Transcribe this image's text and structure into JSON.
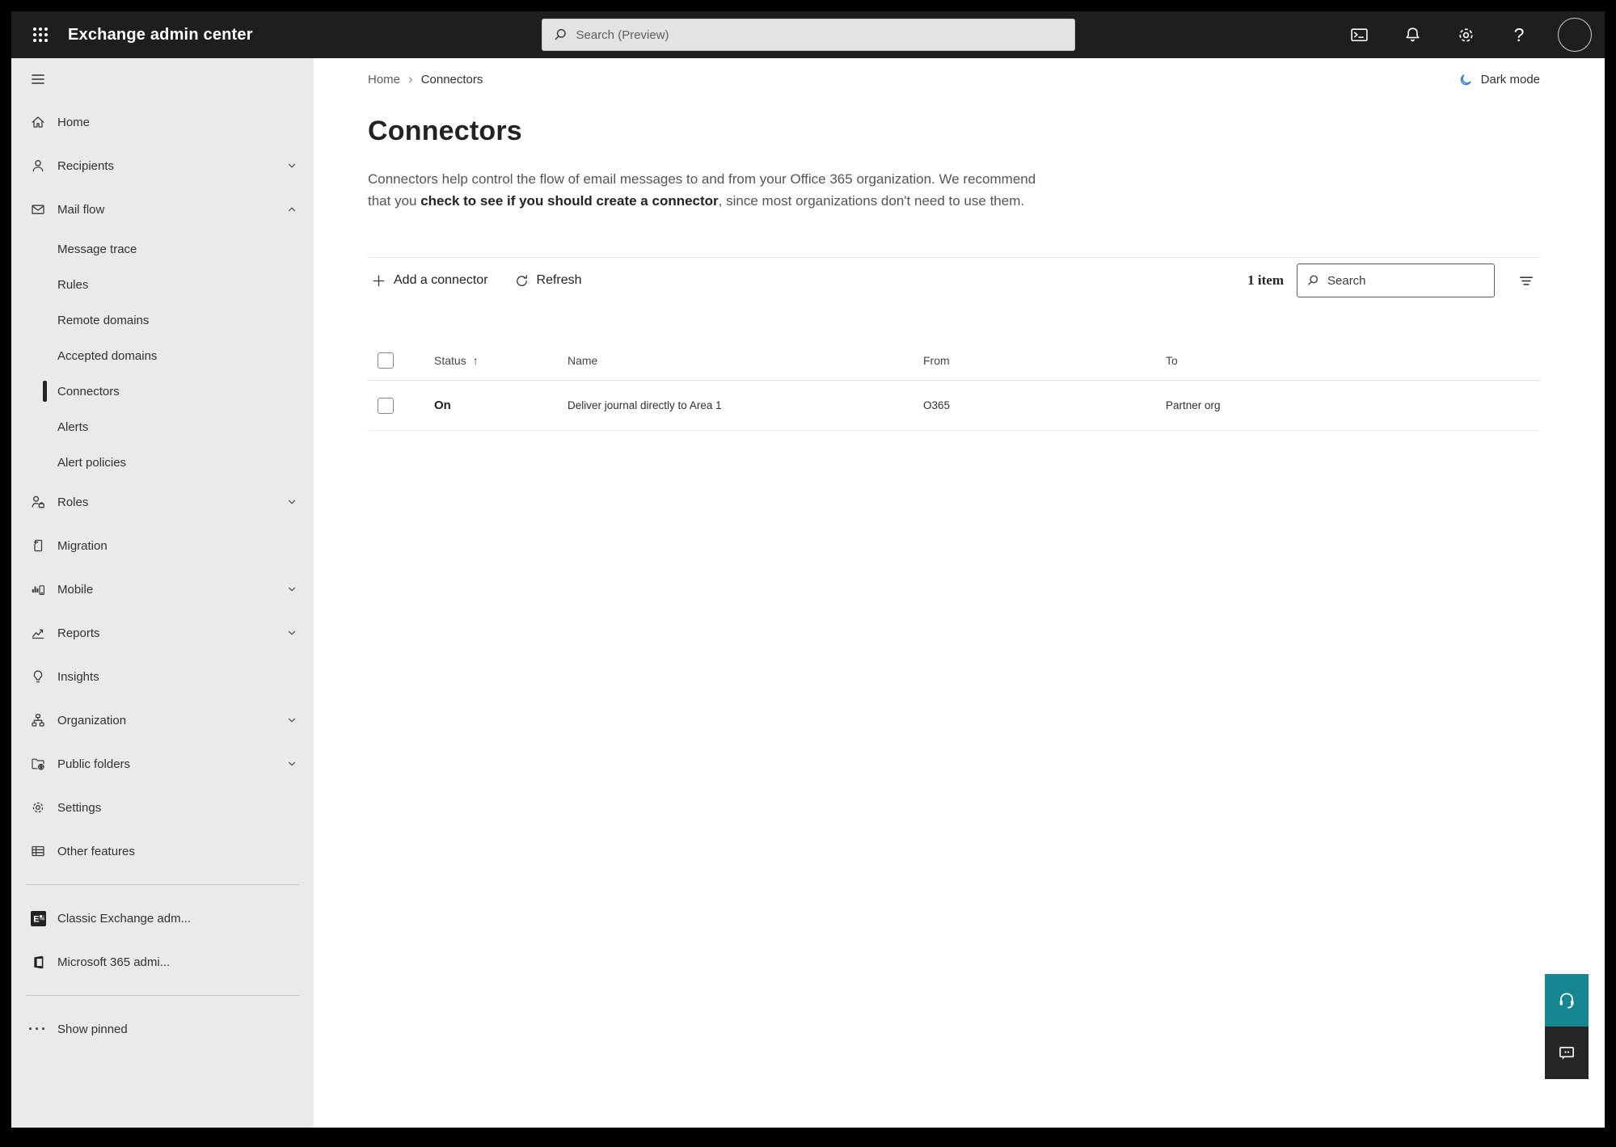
{
  "topbar": {
    "title": "Exchange admin center",
    "search_placeholder": "Search (Preview)",
    "help_glyph": "?"
  },
  "breadcrumb": {
    "home": "Home",
    "separator": "›",
    "current": "Connectors"
  },
  "theme_toggle": {
    "label": "Dark mode"
  },
  "page": {
    "title": "Connectors",
    "description": {
      "part1": "Connectors help control the flow of email messages to and from your Office 365 organization. We recommend that you ",
      "emphasis": "check to see if you should create a connector",
      "part2": ", since most organizations don't need to use them."
    }
  },
  "toolbar": {
    "add_connector_label": "Add a connector",
    "refresh_label": "Refresh",
    "item_count": "1 item",
    "search_placeholder": "Search"
  },
  "table": {
    "headers": {
      "status": "Status",
      "name": "Name",
      "from": "From",
      "to": "To"
    },
    "sort_indicator": "↑",
    "rows": [
      {
        "status": "On",
        "name": "Deliver journal directly to Area 1",
        "from": "O365",
        "to": "Partner org"
      }
    ]
  },
  "sidebar": {
    "items": [
      {
        "label": "Home"
      },
      {
        "label": "Recipients"
      },
      {
        "label": "Mail flow"
      },
      {
        "label": "Roles"
      },
      {
        "label": "Migration"
      },
      {
        "label": "Mobile"
      },
      {
        "label": "Reports"
      },
      {
        "label": "Insights"
      },
      {
        "label": "Organization"
      },
      {
        "label": "Public folders"
      },
      {
        "label": "Settings"
      },
      {
        "label": "Other features"
      }
    ],
    "mail_flow_children": [
      "Message trace",
      "Rules",
      "Remote domains",
      "Accepted domains",
      "Connectors",
      "Alerts",
      "Alert policies"
    ],
    "selected": "Connectors",
    "footer_items": [
      "Classic Exchange adm...",
      "Microsoft 365 admi..."
    ],
    "pinned_ellipsis": "···",
    "show_pinned": "Show pinned"
  },
  "colors": {
    "topbar_bg": "#1f1e1e",
    "sidebar_bg": "#eaeaea",
    "support_teal": "#178693",
    "dark_mode_blue": "#2b7cd3"
  }
}
